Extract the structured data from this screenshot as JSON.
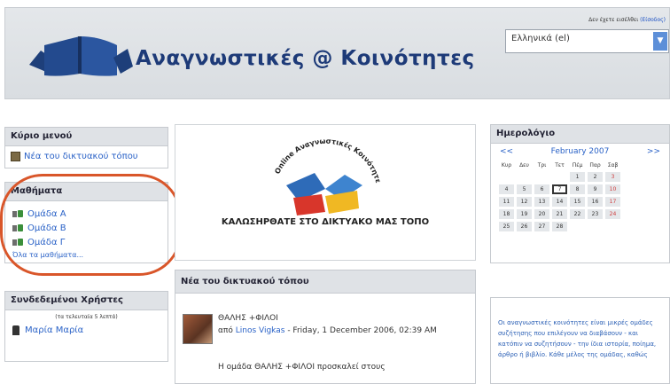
{
  "header": {
    "site_title": "Αναγνωστικές @ Κοινότητες",
    "login_text": "Δεν έχετε εισέλθει",
    "login_link": "(Είσοδος)",
    "language": "Ελληνικά (el)"
  },
  "main_menu": {
    "title": "Κύριο μενού",
    "items": [
      {
        "label": "Νέα του δικτυακού τόπου"
      }
    ]
  },
  "courses": {
    "title": "Μαθήματα",
    "items": [
      {
        "label": "Ομάδα Α"
      },
      {
        "label": "Ομάδα Β"
      },
      {
        "label": "Ομάδα Γ"
      }
    ],
    "all_label": "Όλα τα μαθήματα..."
  },
  "online_users": {
    "title": "Συνδεδεμένοι Χρήστες",
    "period": "(τα τελευταία 5 λεπτά)",
    "users": [
      {
        "name": "Μαρία Μαρία"
      }
    ]
  },
  "welcome": {
    "logo_text": "Online Αναγνωστικές Κοινότητες",
    "message": "ΚΑΛΩΣΗΡΘΑΤΕ ΣΤΟ ΔΙΚΤΥΑΚΟ ΜΑΣ ΤΟΠΟ"
  },
  "news": {
    "title": "Νέα του δικτυακού τόπου",
    "post": {
      "subject": "ΘΑΛΗΣ +ΦΙΛΟΙ",
      "by": "από",
      "author": "Linos Vigkas",
      "date": " - Friday, 1 December 2006, 02:39 AM",
      "body": "Η ομάδα ΘΑΛΗΣ +ΦΙΛΟΙ προσκαλεί στους"
    }
  },
  "calendar": {
    "title": "Ημερολόγιο",
    "prev": "<<",
    "next": ">>",
    "month": "February 2007",
    "weekdays": [
      "Κυρ",
      "Δευ",
      "Τρι",
      "Τετ",
      "Πέμ",
      "Παρ",
      "Σαβ"
    ],
    "weeks": [
      [
        "",
        "",
        "",
        "",
        "1",
        "2",
        "3"
      ],
      [
        "4",
        "5",
        "6",
        "7",
        "8",
        "9",
        "10"
      ],
      [
        "11",
        "12",
        "13",
        "14",
        "15",
        "16",
        "17"
      ],
      [
        "18",
        "19",
        "20",
        "21",
        "22",
        "23",
        "24"
      ],
      [
        "25",
        "26",
        "27",
        "28",
        "",
        "",
        ""
      ]
    ],
    "today": "7"
  },
  "description": {
    "text": "Οι αναγνωστικές κοινότητες είναι μικρές ομάδες συζήτησης που επιλέγουν να διαβάσουν - και κατόπιν να συζητήσουν - την ίδια ιστορία, ποίημα, άρθρο ή βιβλίο. Κάθε μέλος της ομάδας, καθώς"
  },
  "colors": {
    "header_bg": "#dfe2e6",
    "link": "#2a62c7",
    "title": "#1d3a78",
    "highlight_ring": "#d9562a"
  }
}
